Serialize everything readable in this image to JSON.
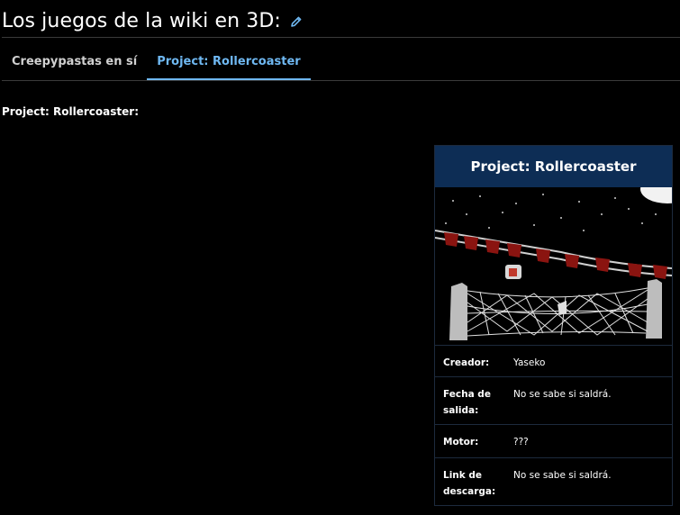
{
  "page": {
    "title": "Los juegos de la wiki en 3D:",
    "tabs": [
      {
        "label": "Creepypastas en sí",
        "active": false
      },
      {
        "label": "Project: Rollercoaster",
        "active": true
      }
    ],
    "section_heading": "Project: Rollercoaster:"
  },
  "infobox": {
    "title": "Project: Rollercoaster",
    "rows": [
      {
        "label": "Creador:",
        "value": "Yaseko"
      },
      {
        "label": "Fecha de salida:",
        "value": "No se sabe si saldrá."
      },
      {
        "label": "Motor:",
        "value": "???"
      },
      {
        "label": "Link de descarga:",
        "value": "No se sabe si saldrá."
      }
    ]
  },
  "colors": {
    "background": "#000000",
    "accent": "#6fb8f2",
    "infobox_header": "#0d2d55",
    "divider": "#3a3a3a"
  },
  "icons": {
    "edit": "pencil-icon"
  }
}
